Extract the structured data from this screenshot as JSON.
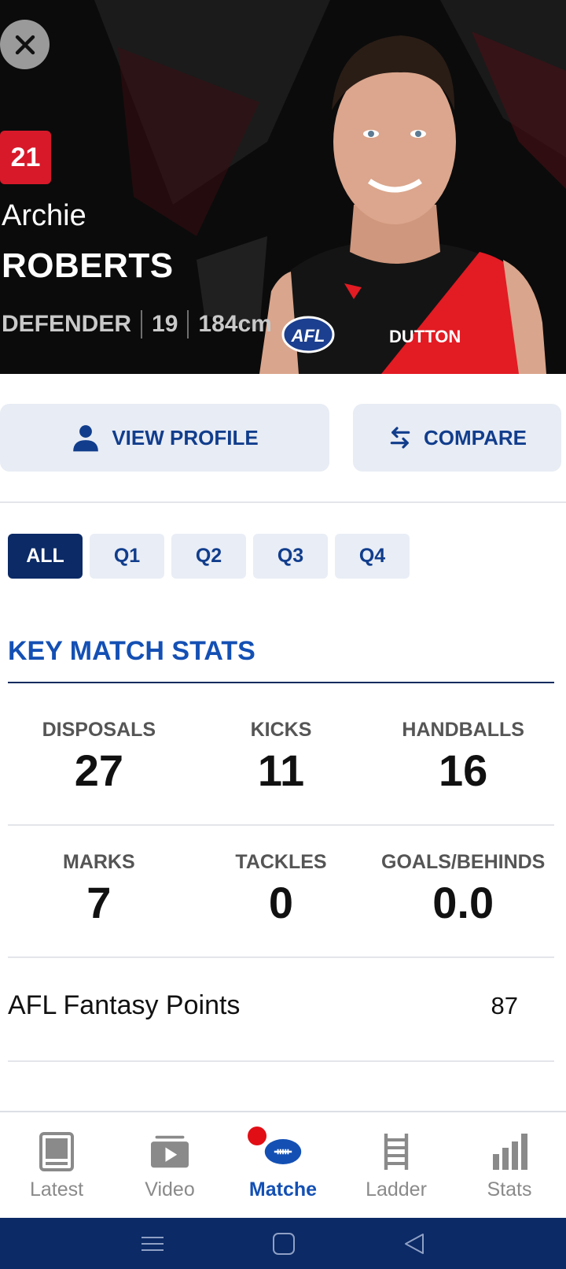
{
  "player": {
    "number": "21",
    "first_name": "Archie",
    "last_name": "ROBERTS",
    "position": "DEFENDER",
    "age": "19",
    "height": "184cm",
    "jersey_text": "DUTTON",
    "logo_text": "AFL"
  },
  "actions": {
    "view_profile": "VIEW PROFILE",
    "compare": "COMPARE"
  },
  "tabs": [
    {
      "label": "ALL",
      "active": true
    },
    {
      "label": "Q1",
      "active": false
    },
    {
      "label": "Q2",
      "active": false
    },
    {
      "label": "Q3",
      "active": false
    },
    {
      "label": "Q4",
      "active": false
    }
  ],
  "key_stats": {
    "title": "KEY MATCH STATS",
    "row1": [
      {
        "label": "DISPOSALS",
        "value": "27"
      },
      {
        "label": "KICKS",
        "value": "11"
      },
      {
        "label": "HANDBALLS",
        "value": "16"
      }
    ],
    "row2": [
      {
        "label": "MARKS",
        "value": "7"
      },
      {
        "label": "TACKLES",
        "value": "0"
      },
      {
        "label": "GOALS/BEHINDS",
        "value": "0.0"
      }
    ],
    "fantasy_label": "AFL Fantasy Points",
    "fantasy_value": "87"
  },
  "nav": [
    {
      "label": "Latest",
      "icon": "news-icon",
      "active": false
    },
    {
      "label": "Video",
      "icon": "video-play-icon",
      "active": false
    },
    {
      "label": "Matche",
      "icon": "football-icon",
      "active": true
    },
    {
      "label": "Ladder",
      "icon": "ladder-icon",
      "active": false
    },
    {
      "label": "Stats",
      "icon": "bar-chart-icon",
      "active": false
    }
  ],
  "colors": {
    "navy": "#0b2a66",
    "blue": "#1450b4",
    "red": "#d7192a"
  }
}
